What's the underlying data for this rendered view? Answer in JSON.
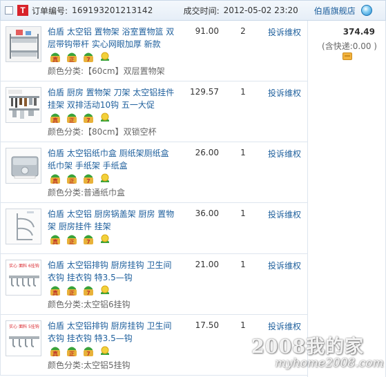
{
  "order": {
    "tmall_badge": "T",
    "order_label": "订单编号:",
    "order_no": "169193201213142",
    "time_label": "成交时间:",
    "time": "2012-05-02 23:20",
    "shop": "伯盾旗舰店"
  },
  "summary": {
    "total": "374.49",
    "shipping": "(含快递:0.00 )"
  },
  "items": [
    {
      "title": "伯盾 太空铝 置物架 浴室置物篮 双层带钩带杆 实心网眼加厚 新款",
      "price": "91.00",
      "qty": "2",
      "complain": "投诉维权",
      "spec": "颜色分类:【60cm】双层置物架"
    },
    {
      "title": "伯盾 厨房 置物架 刀架 太空铝挂件挂架 双排活动10钩 五一大促",
      "price": "129.57",
      "qty": "1",
      "complain": "投诉维权",
      "spec": "颜色分类:【80cm】双锁空杯"
    },
    {
      "title": "伯盾 太空铝纸巾盒 厕纸架厕纸盒 纸巾架 手纸架 手纸盒",
      "price": "26.00",
      "qty": "1",
      "complain": "投诉维权",
      "spec": "颜色分类:普通纸巾盒"
    },
    {
      "title": "伯盾 太空铝 厨房锅盖架 厨房 置物架 厨房挂件 挂架",
      "price": "36.00",
      "qty": "1",
      "complain": "投诉维权",
      "spec": ""
    },
    {
      "title": "伯盾 太空铝排钩 厨房挂钩 卫生间 衣钩 挂衣钩 特3.5—钩",
      "price": "21.00",
      "qty": "1",
      "complain": "投诉维权",
      "spec": "颜色分类:太空铝6挂钩"
    },
    {
      "title": "伯盾 太空铝排钩 厨房挂钩 卫生间 衣钩 挂衣钩 特3.5—钩",
      "price": "17.50",
      "qty": "1",
      "complain": "投诉维权",
      "spec": "颜色分类:太空铝5挂钩"
    }
  ],
  "badges": {
    "real": "真",
    "genuine": "正",
    "seven": "7"
  },
  "thumb_text": {
    "hooks": "实心 面料 6挂钩",
    "hooks2": "实心 面料 5挂钩"
  },
  "watermark": {
    "main": "2008我的家",
    "sub": "myhome2008.com"
  },
  "colors": {
    "link": "#1e5f9c",
    "tmall": "#d8232a",
    "border": "#dde5ee"
  }
}
